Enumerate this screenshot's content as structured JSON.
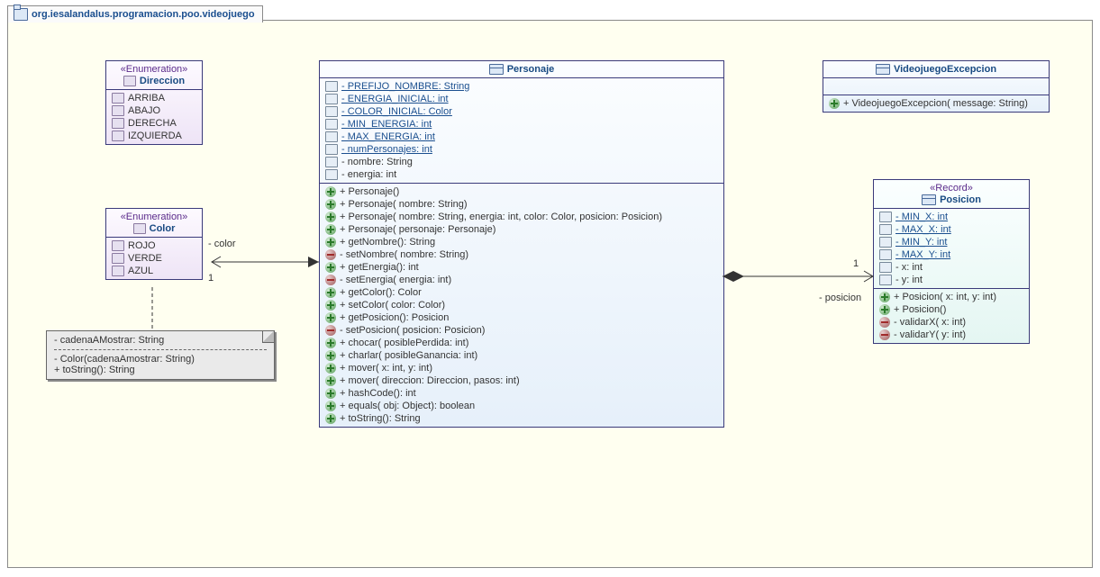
{
  "package": {
    "name": "org.iesalandalus.programacion.poo.videojuego"
  },
  "direccion": {
    "stereo": "«Enumeration»",
    "name": "Direccion",
    "literals": [
      "ARRIBA",
      "ABAJO",
      "DERECHA",
      "IZQUIERDA"
    ]
  },
  "color": {
    "stereo": "«Enumeration»",
    "name": "Color",
    "literals": [
      "ROJO",
      "VERDE",
      "AZUL"
    ]
  },
  "colorNote": {
    "attr": "- cadenaAMostrar: String",
    "ctor": "- Color(cadenaAmostrar: String)",
    "m1": "+ toString(): String"
  },
  "personaje": {
    "name": "Personaje",
    "attrs": [
      {
        "t": "- PREFIJO_NOMBRE: String",
        "s": true
      },
      {
        "t": "- ENERGIA_INICIAL: int",
        "s": true
      },
      {
        "t": "- COLOR_INICIAL: Color",
        "s": true
      },
      {
        "t": "- MIN_ENERGIA: int",
        "s": true
      },
      {
        "t": "- MAX_ENERGIA: int",
        "s": true
      },
      {
        "t": "- numPersonajes: int",
        "s": true
      },
      {
        "t": "- nombre: String",
        "s": false
      },
      {
        "t": "- energia: int",
        "s": false
      }
    ],
    "ops": [
      {
        "v": "pub",
        "t": "+ Personaje()"
      },
      {
        "v": "pub",
        "t": "+ Personaje(  nombre: String)"
      },
      {
        "v": "pub",
        "t": "+ Personaje(  nombre: String,   energia: int,   color: Color,   posicion: Posicion)"
      },
      {
        "v": "pub",
        "t": "+ Personaje(  personaje: Personaje)"
      },
      {
        "v": "pub",
        "t": "+ getNombre(): String"
      },
      {
        "v": "priv",
        "t": "- setNombre(  nombre: String)"
      },
      {
        "v": "pub",
        "t": "+ getEnergia(): int"
      },
      {
        "v": "priv",
        "t": "- setEnergia(  energia: int)"
      },
      {
        "v": "pub",
        "t": "+ getColor(): Color"
      },
      {
        "v": "pub",
        "t": "+ setColor(  color: Color)"
      },
      {
        "v": "pub",
        "t": "+ getPosicion(): Posicion"
      },
      {
        "v": "priv",
        "t": "- setPosicion(  posicion: Posicion)"
      },
      {
        "v": "pub",
        "t": "+ chocar(  posiblePerdida: int)"
      },
      {
        "v": "pub",
        "t": "+ charlar(  posibleGanancia: int)"
      },
      {
        "v": "pub",
        "t": "+ mover(  x: int,   y: int)"
      },
      {
        "v": "pub",
        "t": "+ mover(  direccion: Direccion,   pasos: int)"
      },
      {
        "v": "pub",
        "t": "+ hashCode(): int"
      },
      {
        "v": "pub",
        "t": "+ equals(  obj: Object): boolean"
      },
      {
        "v": "pub",
        "t": "+ toString(): String"
      }
    ]
  },
  "excepcion": {
    "name": "VideojuegoExcepcion",
    "ops": [
      {
        "v": "pub",
        "t": "+ VideojuegoExcepcion(  message: String)"
      }
    ]
  },
  "posicion": {
    "stereo": "«Record»",
    "name": "Posicion",
    "attrs": [
      {
        "t": "- MIN_X: int",
        "s": true,
        "v": "pub"
      },
      {
        "t": "- MAX_X: int",
        "s": true,
        "v": "pub"
      },
      {
        "t": "- MIN_Y: int",
        "s": true,
        "v": "pub"
      },
      {
        "t": "- MAX_Y: int",
        "s": true,
        "v": "pub"
      },
      {
        "t": "- x: int",
        "s": false,
        "v": "priv"
      },
      {
        "t": "- y: int",
        "s": false,
        "v": "priv"
      }
    ],
    "ops": [
      {
        "v": "pub",
        "t": "+ Posicion(  x: int,   y: int)"
      },
      {
        "v": "pub",
        "t": "+ Posicion()"
      },
      {
        "v": "priv",
        "t": "- validarX(  x: int)"
      },
      {
        "v": "priv",
        "t": "- validarY(  y: int)"
      }
    ]
  },
  "assoc": {
    "colorRole": "- color",
    "colorMult": "1",
    "posRole": "- posicion",
    "posMult": "1"
  },
  "chart_data": {
    "type": "table",
    "description": "UML class diagram for package org.iesalandalus.programacion.poo.videojuego",
    "classes": [
      {
        "name": "Direccion",
        "kind": "enumeration",
        "literals": [
          "ARRIBA",
          "ABAJO",
          "DERECHA",
          "IZQUIERDA"
        ]
      },
      {
        "name": "Color",
        "kind": "enumeration",
        "literals": [
          "ROJO",
          "VERDE",
          "AZUL"
        ],
        "attributes": [
          {
            "name": "cadenaAMostrar",
            "type": "String",
            "visibility": "private"
          }
        ],
        "operations": [
          {
            "signature": "Color(cadenaAmostrar: String)",
            "visibility": "private"
          },
          {
            "signature": "toString(): String",
            "visibility": "public"
          }
        ]
      },
      {
        "name": "Personaje",
        "kind": "class",
        "attributes": [
          {
            "name": "PREFIJO_NOMBRE",
            "type": "String",
            "visibility": "private",
            "static": true
          },
          {
            "name": "ENERGIA_INICIAL",
            "type": "int",
            "visibility": "private",
            "static": true
          },
          {
            "name": "COLOR_INICIAL",
            "type": "Color",
            "visibility": "private",
            "static": true
          },
          {
            "name": "MIN_ENERGIA",
            "type": "int",
            "visibility": "private",
            "static": true
          },
          {
            "name": "MAX_ENERGIA",
            "type": "int",
            "visibility": "private",
            "static": true
          },
          {
            "name": "numPersonajes",
            "type": "int",
            "visibility": "private",
            "static": true
          },
          {
            "name": "nombre",
            "type": "String",
            "visibility": "private"
          },
          {
            "name": "energia",
            "type": "int",
            "visibility": "private"
          }
        ],
        "operations": [
          {
            "signature": "Personaje()",
            "visibility": "public"
          },
          {
            "signature": "Personaje(nombre: String)",
            "visibility": "public"
          },
          {
            "signature": "Personaje(nombre: String, energia: int, color: Color, posicion: Posicion)",
            "visibility": "public"
          },
          {
            "signature": "Personaje(personaje: Personaje)",
            "visibility": "public"
          },
          {
            "signature": "getNombre(): String",
            "visibility": "public"
          },
          {
            "signature": "setNombre(nombre: String)",
            "visibility": "private"
          },
          {
            "signature": "getEnergia(): int",
            "visibility": "public"
          },
          {
            "signature": "setEnergia(energia: int)",
            "visibility": "private"
          },
          {
            "signature": "getColor(): Color",
            "visibility": "public"
          },
          {
            "signature": "setColor(color: Color)",
            "visibility": "public"
          },
          {
            "signature": "getPosicion(): Posicion",
            "visibility": "public"
          },
          {
            "signature": "setPosicion(posicion: Posicion)",
            "visibility": "private"
          },
          {
            "signature": "chocar(posiblePerdida: int)",
            "visibility": "public"
          },
          {
            "signature": "charlar(posibleGanancia: int)",
            "visibility": "public"
          },
          {
            "signature": "mover(x: int, y: int)",
            "visibility": "public"
          },
          {
            "signature": "mover(direccion: Direccion, pasos: int)",
            "visibility": "public"
          },
          {
            "signature": "hashCode(): int",
            "visibility": "public"
          },
          {
            "signature": "equals(obj: Object): boolean",
            "visibility": "public"
          },
          {
            "signature": "toString(): String",
            "visibility": "public"
          }
        ]
      },
      {
        "name": "VideojuegoExcepcion",
        "kind": "class",
        "operations": [
          {
            "signature": "VideojuegoExcepcion(message: String)",
            "visibility": "public"
          }
        ]
      },
      {
        "name": "Posicion",
        "kind": "record",
        "attributes": [
          {
            "name": "MIN_X",
            "type": "int",
            "visibility": "public",
            "static": true
          },
          {
            "name": "MAX_X",
            "type": "int",
            "visibility": "public",
            "static": true
          },
          {
            "name": "MIN_Y",
            "type": "int",
            "visibility": "public",
            "static": true
          },
          {
            "name": "MAX_Y",
            "type": "int",
            "visibility": "public",
            "static": true
          },
          {
            "name": "x",
            "type": "int",
            "visibility": "private"
          },
          {
            "name": "y",
            "type": "int",
            "visibility": "private"
          }
        ],
        "operations": [
          {
            "signature": "Posicion(x: int, y: int)",
            "visibility": "public"
          },
          {
            "signature": "Posicion()",
            "visibility": "public"
          },
          {
            "signature": "validarX(x: int)",
            "visibility": "private"
          },
          {
            "signature": "validarY(y: int)",
            "visibility": "private"
          }
        ]
      }
    ],
    "associations": [
      {
        "from": "Personaje",
        "to": "Color",
        "role": "color",
        "multiplicity": "1",
        "aggregation": "none",
        "navigable": "to"
      },
      {
        "from": "Personaje",
        "to": "Posicion",
        "role": "posicion",
        "multiplicity": "1",
        "aggregation": "composite",
        "navigable": "to"
      }
    ],
    "notes": [
      {
        "attachedTo": "Color",
        "text": "- cadenaAMostrar: String\n- Color(cadenaAmostrar: String)\n+ toString(): String"
      }
    ]
  }
}
